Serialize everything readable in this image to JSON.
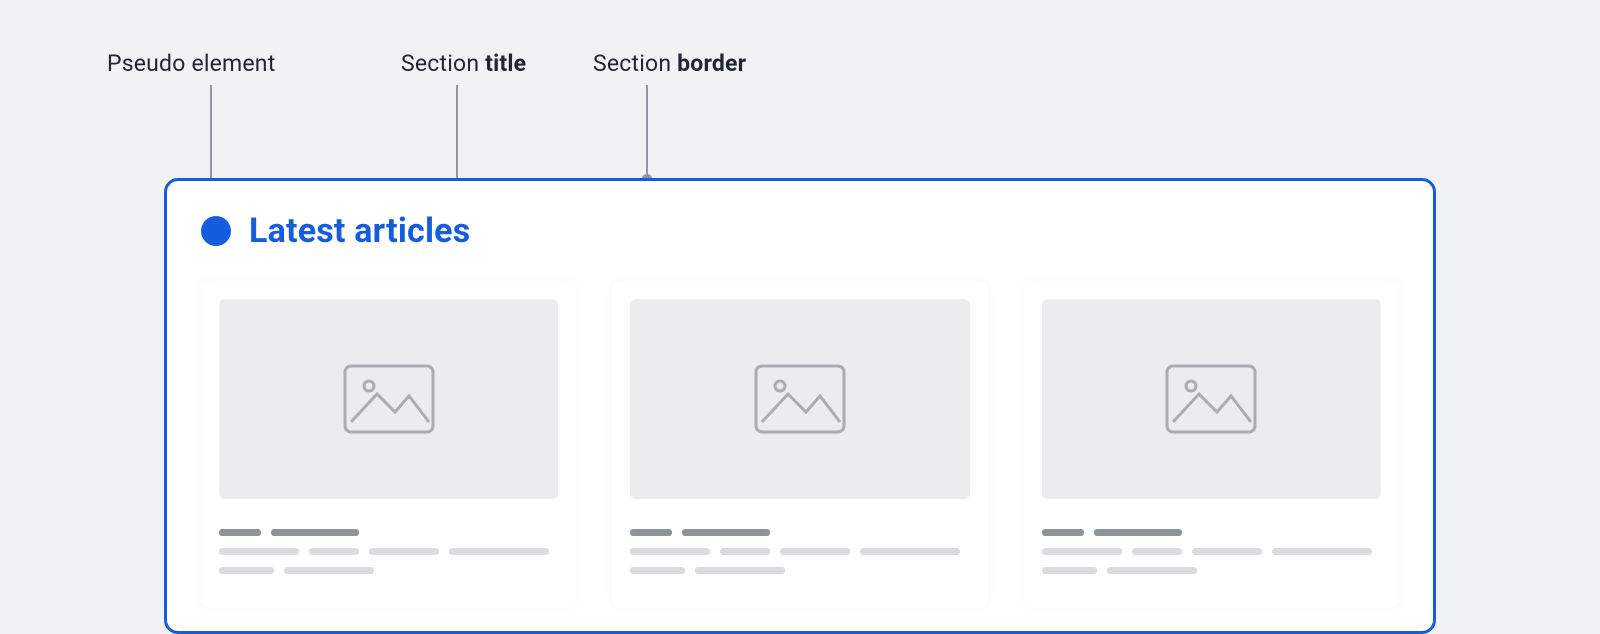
{
  "annotations": {
    "pseudo": "Pseudo element",
    "title_prefix": "Section ",
    "title_bold": "title",
    "border_prefix": "Section ",
    "border_bold": "border"
  },
  "section": {
    "title": "Latest articles"
  }
}
